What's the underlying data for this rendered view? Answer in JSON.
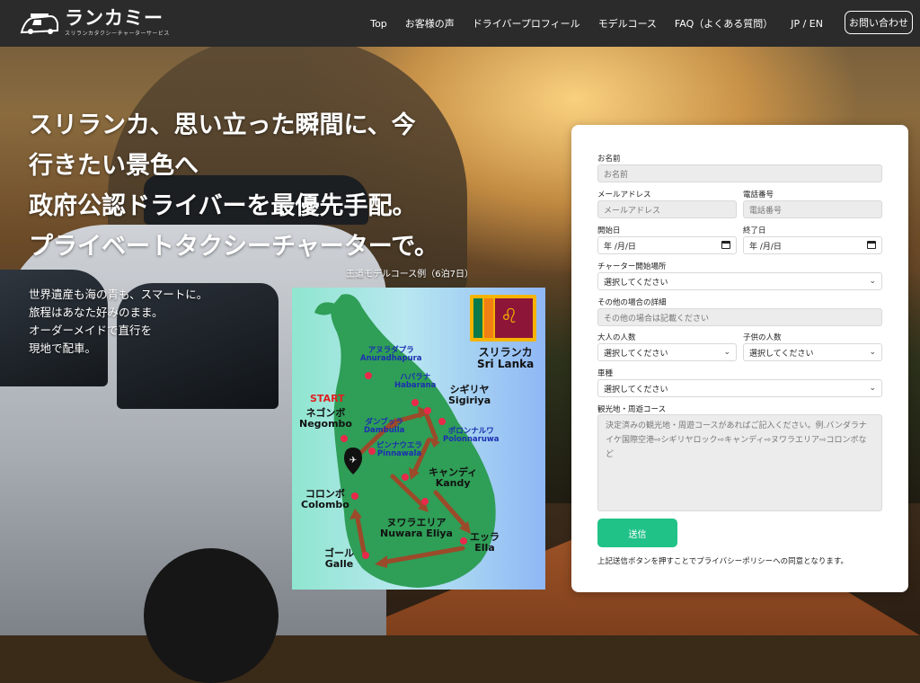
{
  "brand": {
    "name": "ランカミー",
    "tagline": "スリランカタクシーチャーターサービス"
  },
  "nav": {
    "links": [
      "Top",
      "お客様の声",
      "ドライバープロフィール",
      "モデルコース",
      "FAQ（よくある質問）",
      "JP / EN"
    ],
    "contact_label": "お問い合わせ"
  },
  "hero": {
    "headline": [
      "スリランカ、思い立った瞬間に、今",
      "行きたい景色へ",
      "政府公認ドライバーを最優先手配。",
      "プライベートタクシーチャーターで。"
    ],
    "subcopy": [
      "世界遺産も海の青も、スマートに。",
      "旅程はあなた好みのまま。",
      "オーダーメイドで直行を",
      "現地で配車。"
    ],
    "map_caption": "王道モデルコース例（6泊7日）"
  },
  "map": {
    "country_jp": "スリランカ",
    "country_en": "Sri Lanka",
    "start_label": "START",
    "places": [
      {
        "jp": "アヌラダプラ",
        "en": "Anuradhapura"
      },
      {
        "jp": "ハバラナ",
        "en": "Habarana"
      },
      {
        "jp": "シギリヤ",
        "en": "Sigiriya"
      },
      {
        "jp": "ネゴンボ",
        "en": "Negombo"
      },
      {
        "jp": "ダンブッラ",
        "en": "Dambulla"
      },
      {
        "jp": "ポロンナルワ",
        "en": "Polonnaruwa"
      },
      {
        "jp": "ピンナウエラ",
        "en": "Pinnawala"
      },
      {
        "jp": "キャンディ",
        "en": "Kandy"
      },
      {
        "jp": "コロンボ",
        "en": "Colombo"
      },
      {
        "jp": "ヌワラエリア",
        "en": "Nuwara Eliya"
      },
      {
        "jp": "エッラ",
        "en": "Ella"
      },
      {
        "jp": "ゴール",
        "en": "Galle"
      }
    ],
    "colors": {
      "island": "#2f9e57",
      "arrow": "#9b4a2a",
      "pin": "#e8294a"
    }
  },
  "form": {
    "name_label": "お名前",
    "name_placeholder": "お名前",
    "email_label": "メールアドレス",
    "email_placeholder": "メールアドレス",
    "phone_label": "電話番号",
    "phone_placeholder": "電話番号",
    "start_date_label": "開始日",
    "start_date_value": "年 /月/日",
    "end_date_label": "終了日",
    "end_date_value": "年 /月/日",
    "start_place_label": "チャーター開始場所",
    "select_placeholder": "選択してください",
    "other_label": "その他の場合の詳細",
    "other_placeholder": "その他の場合は記載ください",
    "adults_label": "大人の人数",
    "children_label": "子供の人数",
    "vehicle_label": "車種",
    "course_label": "観光地・周遊コース",
    "course_placeholder": "決定済みの観光地・周遊コースがあればご記入ください。例.バンダラナイケ国際空港⇨シギリヤロック⇨キャンディ⇨ヌワラエリア⇨コロンボなど",
    "submit_label": "送信",
    "privacy_note": "上記送信ボタンを押すことでプライバシーポリシーへの同意となります。",
    "accent_color": "#20c288"
  }
}
